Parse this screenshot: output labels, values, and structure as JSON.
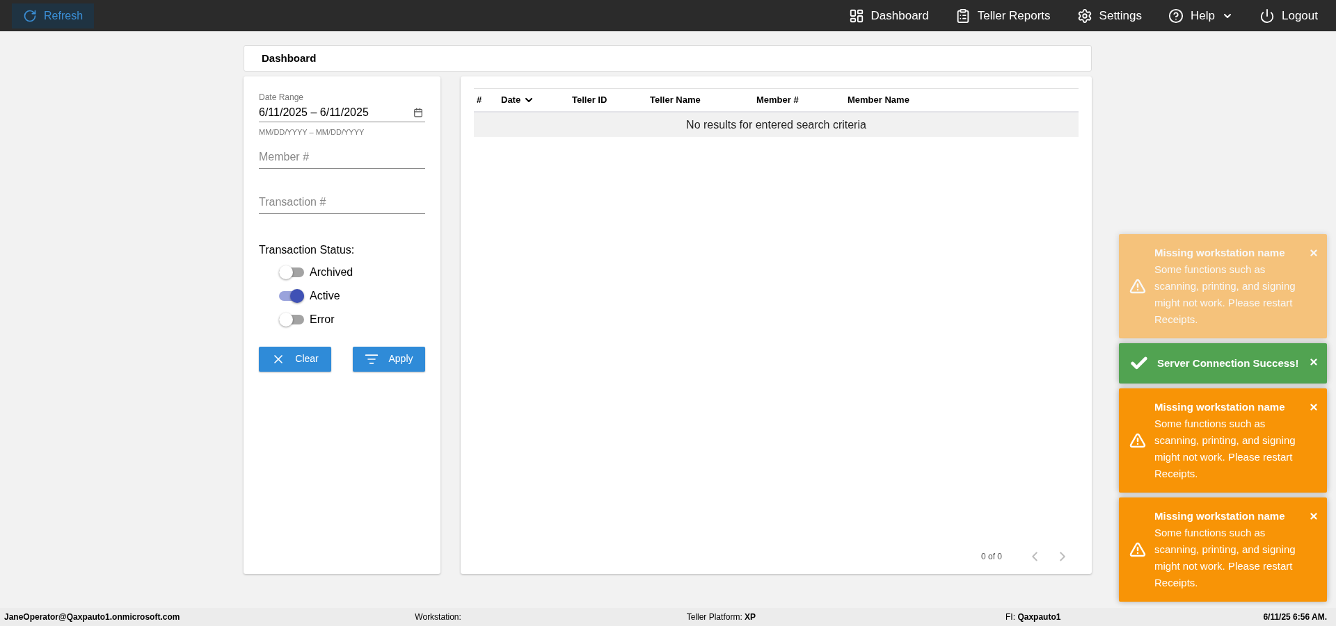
{
  "topbar": {
    "refresh": "Refresh",
    "nav": [
      {
        "kind": "dashboard",
        "label": "Dashboard",
        "dropdown": false
      },
      {
        "kind": "reports",
        "label": "Teller Reports",
        "dropdown": false
      },
      {
        "kind": "settings",
        "label": "Settings",
        "dropdown": false
      },
      {
        "kind": "help",
        "label": "Help",
        "dropdown": true
      },
      {
        "kind": "logout",
        "label": "Logout",
        "dropdown": false
      }
    ]
  },
  "page_title": "Dashboard",
  "filters": {
    "date_range": {
      "label": "Date Range",
      "value": "6/11/2025 – 6/11/2025",
      "hint": "MM/DD/YYYY – MM/DD/YYYY"
    },
    "fields": [
      {
        "placeholder": "Member #"
      },
      {
        "placeholder": "Transaction #"
      }
    ],
    "status_label": "Transaction Status:",
    "statuses": [
      {
        "label": "Archived",
        "on": false
      },
      {
        "label": "Active",
        "on": true
      },
      {
        "label": "Error",
        "on": false
      }
    ],
    "buttons": [
      {
        "kind": "clear",
        "label": "Clear"
      },
      {
        "kind": "apply",
        "label": "Apply"
      }
    ]
  },
  "table": {
    "columns": [
      {
        "label": "#",
        "sorted": false
      },
      {
        "label": "Date",
        "sorted": true
      },
      {
        "label": "Teller ID",
        "sorted": false
      },
      {
        "label": "Teller Name",
        "sorted": false
      },
      {
        "label": "Member #",
        "sorted": false
      },
      {
        "label": "Member Name",
        "sorted": false
      }
    ],
    "empty": "No results for entered search criteria",
    "pagination": "0 of 0"
  },
  "toasts": [
    {
      "kind": "warning",
      "fading": true,
      "title": "Missing workstation name",
      "message": "Some functions such as scanning, printing, and signing might not work. Please restart Receipts."
    },
    {
      "kind": "success",
      "fading": false,
      "title": "Server Connection Success!"
    },
    {
      "kind": "warning",
      "fading": false,
      "title": "Missing workstation name",
      "message": "Some functions such as scanning, printing, and signing might not work. Please restart Receipts."
    },
    {
      "kind": "warning",
      "fading": false,
      "title": "Missing workstation name",
      "message": "Some functions such as scanning, printing, and signing might not work. Please restart Receipts."
    }
  ],
  "status_bar": [
    {
      "value": "JaneOperator@Qaxpauto1.onmicrosoft.com"
    },
    {
      "label": "Workstation:"
    },
    {
      "label": "Teller Platform:",
      "value": "XP"
    },
    {
      "label": "FI:",
      "value": "Qaxpauto1"
    },
    {
      "value": "6/11/25 6:56 AM."
    }
  ]
}
